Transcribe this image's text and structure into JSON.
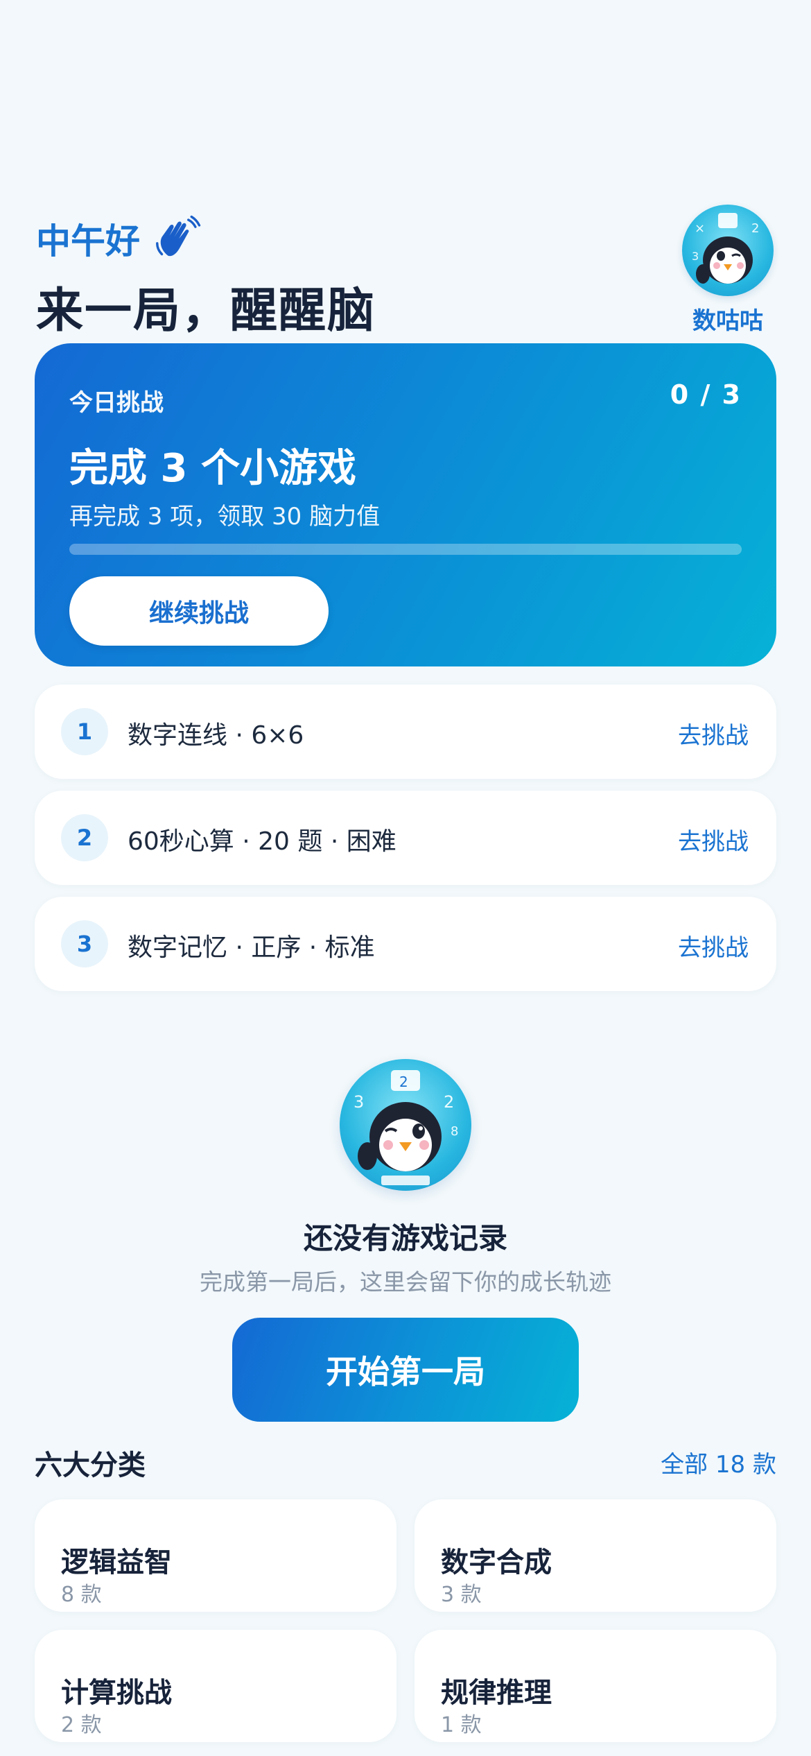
{
  "header": {
    "greeting": "中午好",
    "greeting_icon": "waving-hand-icon",
    "headline": "来一局，醒醒脑",
    "mascot_name": "数咕咕"
  },
  "challenge": {
    "label": "今日挑战",
    "progress_text": "0 / 3",
    "progress_value": 0,
    "title": "完成 3 个小游戏",
    "subtitle": "再完成 3 项，领取 30 脑力值",
    "button_label": "继续挑战"
  },
  "tasks": [
    {
      "num": "1",
      "text": "数字连线 · 6×6",
      "action": "去挑战"
    },
    {
      "num": "2",
      "text": "60秒心算 · 20 题 · 困难",
      "action": "去挑战"
    },
    {
      "num": "3",
      "text": "数字记忆 · 正序 · 标准",
      "action": "去挑战"
    }
  ],
  "empty_state": {
    "title": "还没有游戏记录",
    "subtitle": "完成第一局后，这里会留下你的成长轨迹",
    "button_label": "开始第一局"
  },
  "categories": {
    "heading": "六大分类",
    "all_link": "全部 18 款",
    "items": [
      {
        "name": "逻辑益智",
        "count": "8 款"
      },
      {
        "name": "数字合成",
        "count": "3 款"
      },
      {
        "name": "计算挑战",
        "count": "2 款"
      },
      {
        "name": "规律推理",
        "count": "1 款"
      }
    ]
  },
  "colors": {
    "accent": "#1a73d1",
    "gradient_start": "#1469d4",
    "gradient_end": "#06b2d6",
    "background": "#f2f8fb"
  }
}
